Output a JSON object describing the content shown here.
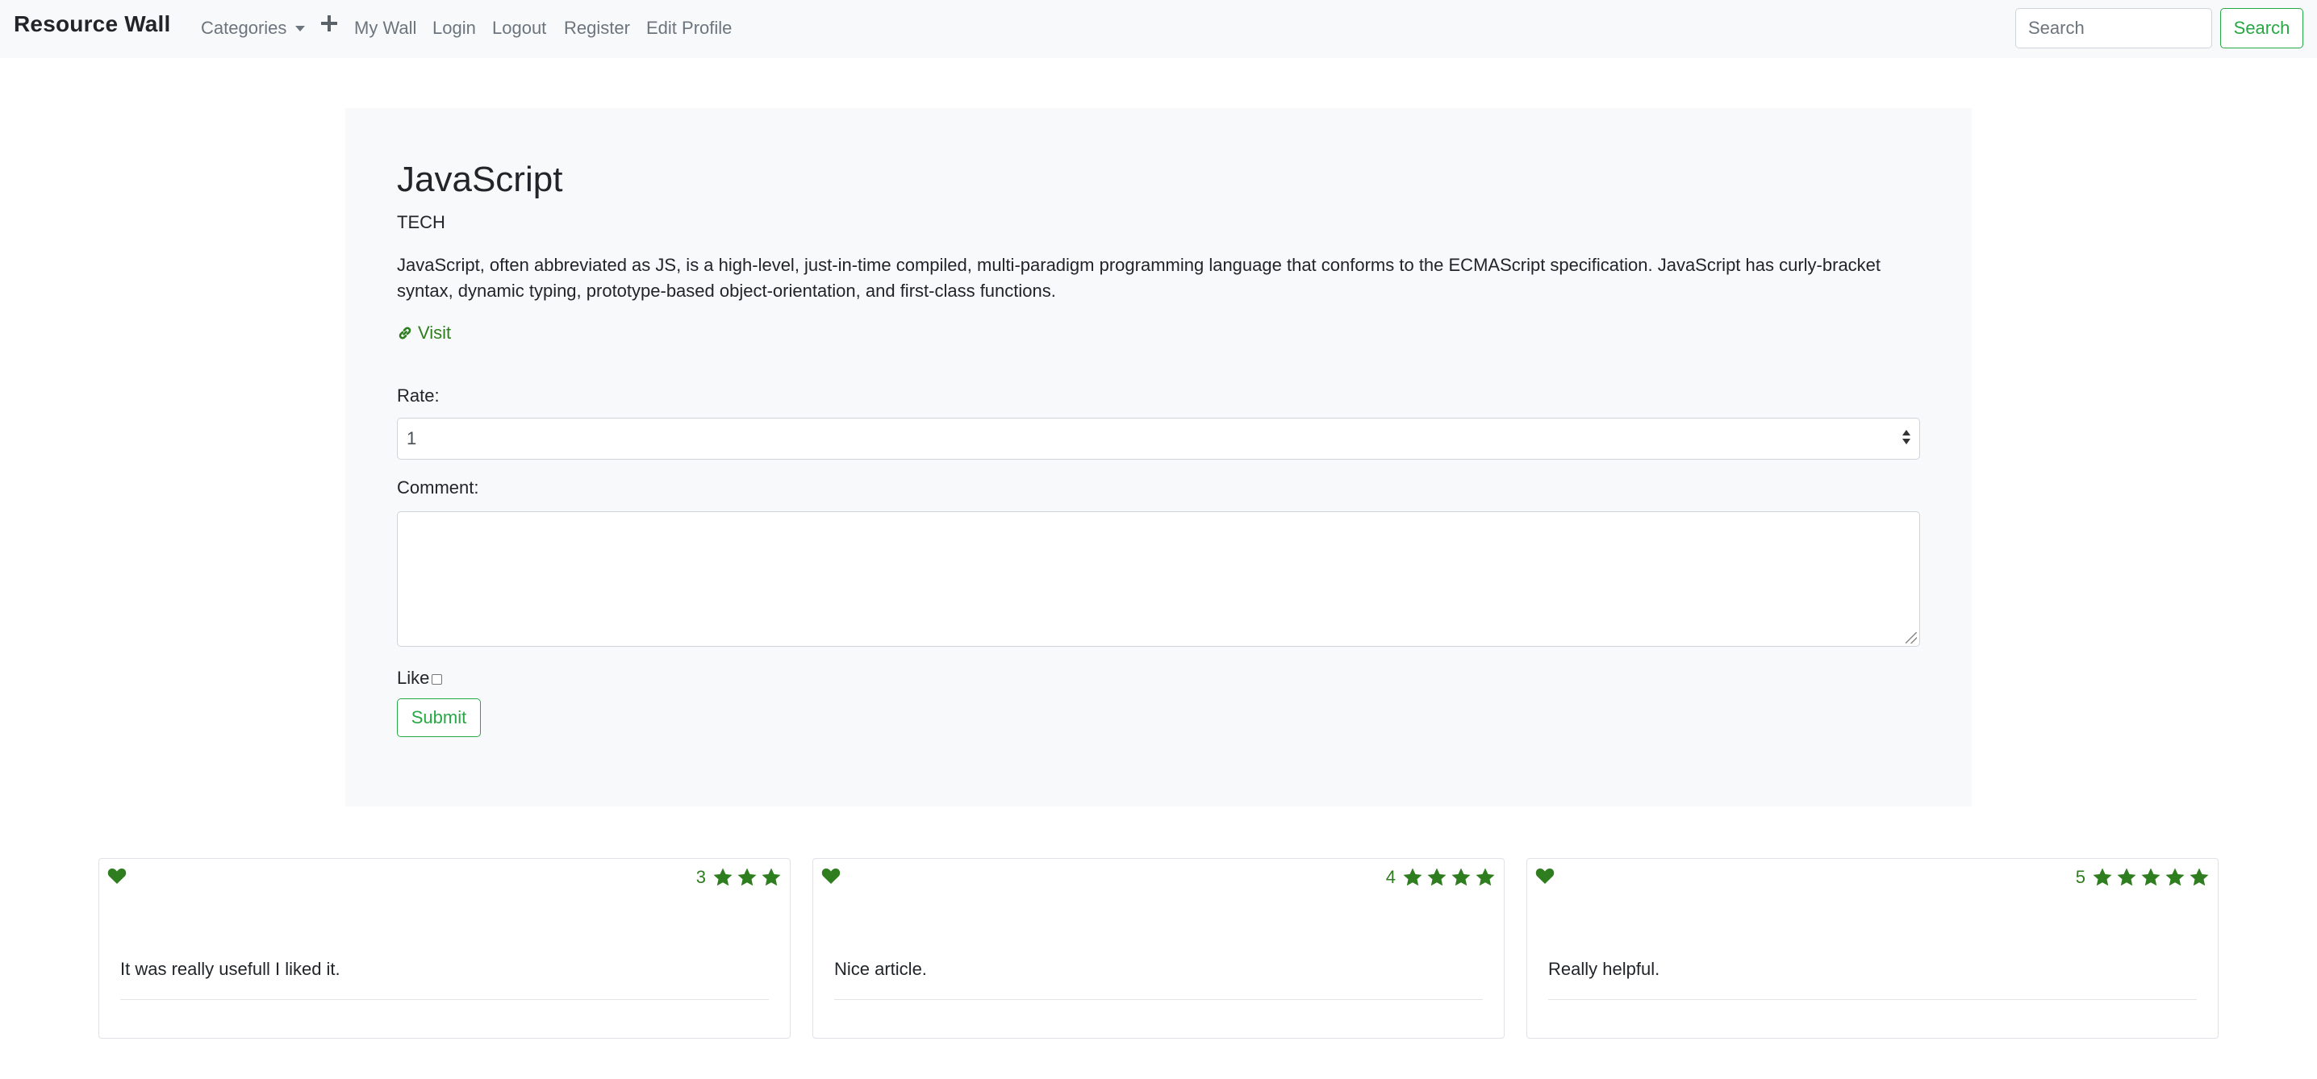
{
  "navbar": {
    "brand": "Resource Wall",
    "categories_label": "Categories",
    "my_wall": "My Wall",
    "login": "Login",
    "logout": "Logout",
    "register": "Register",
    "edit_profile": "Edit Profile",
    "search_placeholder": "Search",
    "search_button": "Search"
  },
  "resource": {
    "title": "JavaScript",
    "category": "TECH",
    "description": "JavaScript, often abbreviated as JS, is a high-level, just-in-time compiled, multi-paradigm programming language that conforms to the ECMAScript specification. JavaScript has curly-bracket syntax, dynamic typing, prototype-based object-orientation, and first-class functions.",
    "visit_label": "Visit"
  },
  "form": {
    "rate_label": "Rate:",
    "rate_value": "1",
    "comment_label": "Comment:",
    "comment_value": "",
    "like_label": "Like",
    "like_checked": false,
    "submit_label": "Submit"
  },
  "comments": [
    {
      "liked": true,
      "rating": "3",
      "stars": 3,
      "text": "It was really usefull I liked it."
    },
    {
      "liked": true,
      "rating": "4",
      "stars": 4,
      "text": "Nice article."
    },
    {
      "liked": true,
      "rating": "5",
      "stars": 5,
      "text": "Really helpful."
    }
  ],
  "colors": {
    "accent": "#28a745",
    "icon_green": "#2e7d1e",
    "nav_bg": "#f8f9fa",
    "nav_link": "#6c757d"
  },
  "icons": {
    "plus": "plus-icon",
    "link": "link-icon",
    "heart": "heart-icon",
    "star": "star-icon"
  }
}
